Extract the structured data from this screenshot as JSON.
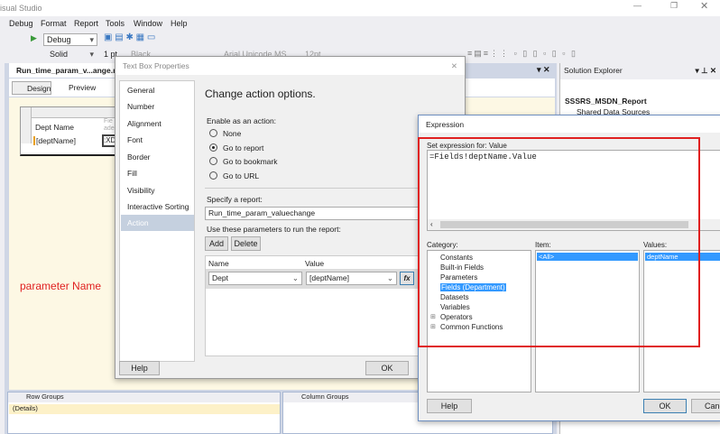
{
  "app": {
    "title": "isual Studio"
  },
  "menu": [
    "Debug",
    "Format",
    "Report",
    "Tools",
    "Window",
    "Help"
  ],
  "toolbar": {
    "config": "Debug",
    "line_style": "Solid",
    "line_width": "1 pt",
    "color": "Black",
    "font": "Arial Unicode MS",
    "font_size": "12pt"
  },
  "document": {
    "tab": "Run_time_param_v...ange.rd",
    "design_tab": "Design",
    "preview_tab": "Preview",
    "table": {
      "header": "Dept Name",
      "header2": "Fie ade",
      "cell": "[deptName]",
      "cell2": ":XD"
    },
    "annotation": "parameter Name"
  },
  "textbox_dialog": {
    "title": "Text Box Properties",
    "nav": [
      "General",
      "Number",
      "Alignment",
      "Font",
      "Border",
      "Fill",
      "Visibility",
      "Interactive Sorting",
      "Action"
    ],
    "heading": "Change action options.",
    "enable_label": "Enable as an action:",
    "radios": [
      "None",
      "Go to report",
      "Go to bookmark",
      "Go to URL"
    ],
    "specify_label": "Specify a report:",
    "report_value": "Run_time_param_valuechange",
    "params_label": "Use these parameters to run the report:",
    "add": "Add",
    "delete": "Delete",
    "col_name": "Name",
    "col_value": "Value",
    "row_name": "Dept",
    "row_value": "[deptName]",
    "fx": "fx",
    "help": "Help",
    "ok": "OK"
  },
  "solution_explorer": {
    "title": "Solution Explorer",
    "project": "SSSRS_MSDN_Report",
    "folder": "Shared Data Sources"
  },
  "expression_dialog": {
    "title": "Expression",
    "set_label": "Set expression for: Value",
    "expression": "=Fields!deptName.Value",
    "category_label": "Category:",
    "item_label": "Item:",
    "values_label": "Values:",
    "categories": [
      "Constants",
      "Built-in Fields",
      "Parameters",
      "Fields (Department)",
      "Datasets",
      "Variables",
      "Operators",
      "Common Functions"
    ],
    "item": "<All>",
    "value": "deptName",
    "help": "Help",
    "ok": "OK",
    "cancel": "Cancel"
  },
  "groups": {
    "row_title": "Row Groups",
    "row_item": "(Details)",
    "col_title": "Column Groups"
  },
  "colors": {
    "highlight": "#3399ff",
    "annotation": "#e02020",
    "design_bg": "#fdf8e4"
  }
}
